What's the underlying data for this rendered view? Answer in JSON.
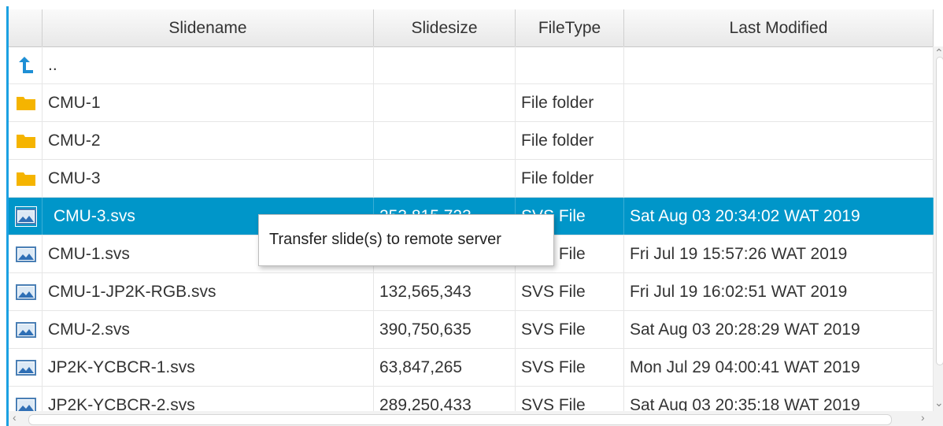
{
  "columns": {
    "icon": "",
    "name": "Slidename",
    "size": "Slidesize",
    "type": "FileType",
    "modified": "Last Modified"
  },
  "colors": {
    "selection": "#0096c9",
    "accent_border": "#1ba1e2",
    "folder": "#f5b400",
    "up_arrow": "#1e8fd5"
  },
  "rows": [
    {
      "icon": "up-arrow-icon",
      "name": "..",
      "size": "",
      "type": "",
      "modified": ""
    },
    {
      "icon": "folder-icon",
      "name": "CMU-1",
      "size": "",
      "type": "File folder",
      "modified": ""
    },
    {
      "icon": "folder-icon",
      "name": "CMU-2",
      "size": "",
      "type": "File folder",
      "modified": ""
    },
    {
      "icon": "folder-icon",
      "name": "CMU-3",
      "size": "",
      "type": "File folder",
      "modified": ""
    },
    {
      "icon": "image-file-icon",
      "name": "CMU-3.svs",
      "size": "253,815,723",
      "type": "SVS File",
      "modified": "Sat Aug 03 20:34:02 WAT 2019",
      "selected": true
    },
    {
      "icon": "image-file-icon",
      "name": "CMU-1.svs",
      "size": "",
      "type": "SVS File",
      "modified": "Fri Jul 19 15:57:26 WAT 2019"
    },
    {
      "icon": "image-file-icon",
      "name": "CMU-1-JP2K-RGB.svs",
      "size": "132,565,343",
      "type": "SVS File",
      "modified": "Fri Jul 19 16:02:51 WAT 2019"
    },
    {
      "icon": "image-file-icon",
      "name": "CMU-2.svs",
      "size": "390,750,635",
      "type": "SVS File",
      "modified": "Sat Aug 03 20:28:29 WAT 2019"
    },
    {
      "icon": "image-file-icon",
      "name": "JP2K-YCBCR-1.svs",
      "size": "63,847,265",
      "type": "SVS File",
      "modified": "Mon Jul 29 04:00:41 WAT 2019"
    },
    {
      "icon": "image-file-icon",
      "name": "JP2K-YCBCR-2.svs",
      "size": "289,250,433",
      "type": "SVS File",
      "modified": "Sat Aug 03 20:35:18 WAT 2019"
    }
  ],
  "tooltip": {
    "text": "Transfer slide(s) to remote server"
  }
}
